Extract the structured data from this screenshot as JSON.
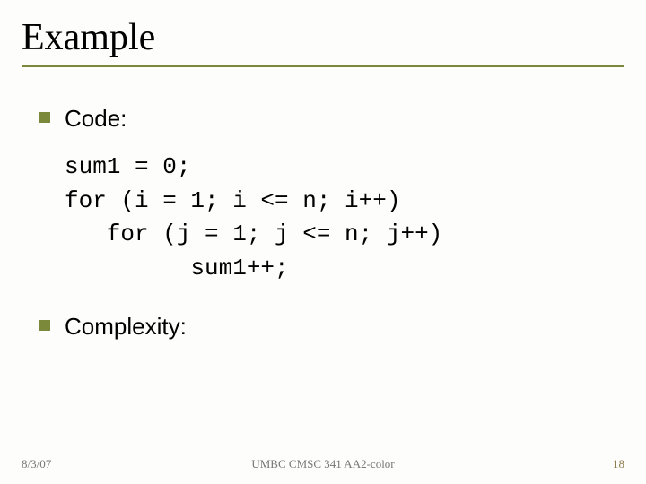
{
  "title": "Example",
  "bullets": [
    {
      "label": "Code:"
    },
    {
      "label": "Complexity:"
    }
  ],
  "code": "sum1 = 0;\nfor (i = 1; i <= n; i++)\n   for (j = 1; j <= n; j++)\n         sum1++;",
  "footer": {
    "date": "8/3/07",
    "course": "UMBC CMSC 341 AA2-color",
    "page": "18"
  },
  "colors": {
    "accent": "#7b8a3a"
  }
}
